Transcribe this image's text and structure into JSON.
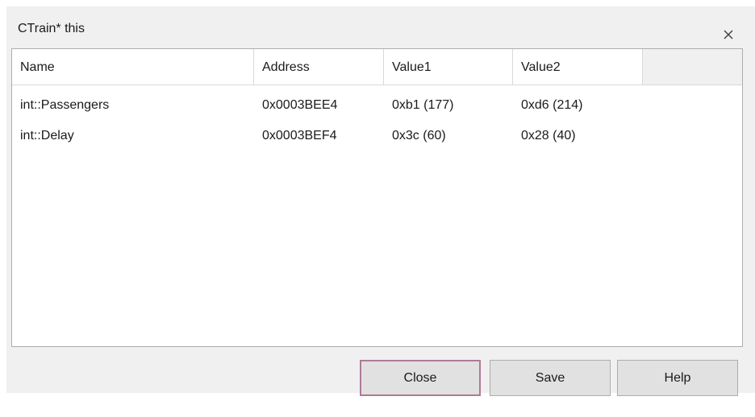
{
  "dialog": {
    "title": "CTrain* this",
    "close_icon": "close-icon"
  },
  "list": {
    "columns": [
      "Name",
      "Address",
      "Value1",
      "Value2",
      ""
    ],
    "rows": [
      {
        "name": "int::Passengers",
        "address": "0x0003BEE4",
        "value1": "0xb1 (177)",
        "value2": "0xd6 (214)"
      },
      {
        "name": "int::Delay",
        "address": "0x0003BEF4",
        "value1": "0x3c (60)",
        "value2": "0x28 (40)"
      }
    ]
  },
  "buttons": {
    "close": "Close",
    "save": "Save",
    "help": "Help"
  },
  "colors": {
    "dialog_bg": "#f0f0f0",
    "default_button_border": "#b07a96"
  }
}
